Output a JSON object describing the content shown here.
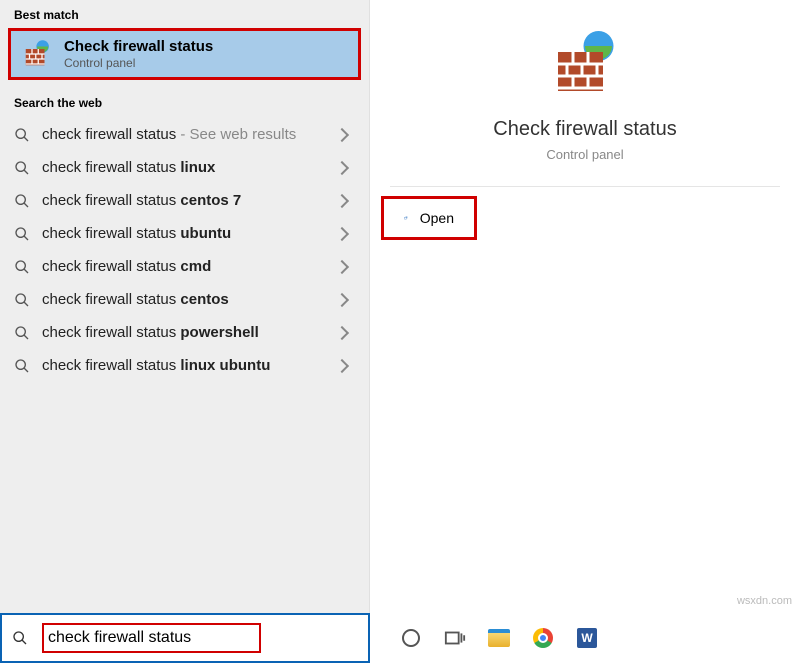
{
  "sections": {
    "best_match": "Best match",
    "search_web": "Search the web"
  },
  "best_match": {
    "title": "Check firewall status",
    "subtitle": "Control panel"
  },
  "web_results": [
    {
      "prefix": "check firewall status",
      "bold": "",
      "suffix": " - See web results"
    },
    {
      "prefix": "check firewall status ",
      "bold": "linux",
      "suffix": ""
    },
    {
      "prefix": "check firewall status ",
      "bold": "centos 7",
      "suffix": ""
    },
    {
      "prefix": "check firewall status ",
      "bold": "ubuntu",
      "suffix": ""
    },
    {
      "prefix": "check firewall status ",
      "bold": "cmd",
      "suffix": ""
    },
    {
      "prefix": "check firewall status ",
      "bold": "centos",
      "suffix": ""
    },
    {
      "prefix": "check firewall status ",
      "bold": "powershell",
      "suffix": ""
    },
    {
      "prefix": "check firewall status ",
      "bold": "linux ubuntu",
      "suffix": ""
    }
  ],
  "details": {
    "title": "Check firewall status",
    "subtitle": "Control panel",
    "actions": {
      "open": "Open"
    }
  },
  "search": {
    "query": "check firewall status"
  },
  "watermark": "wsxdn.com"
}
